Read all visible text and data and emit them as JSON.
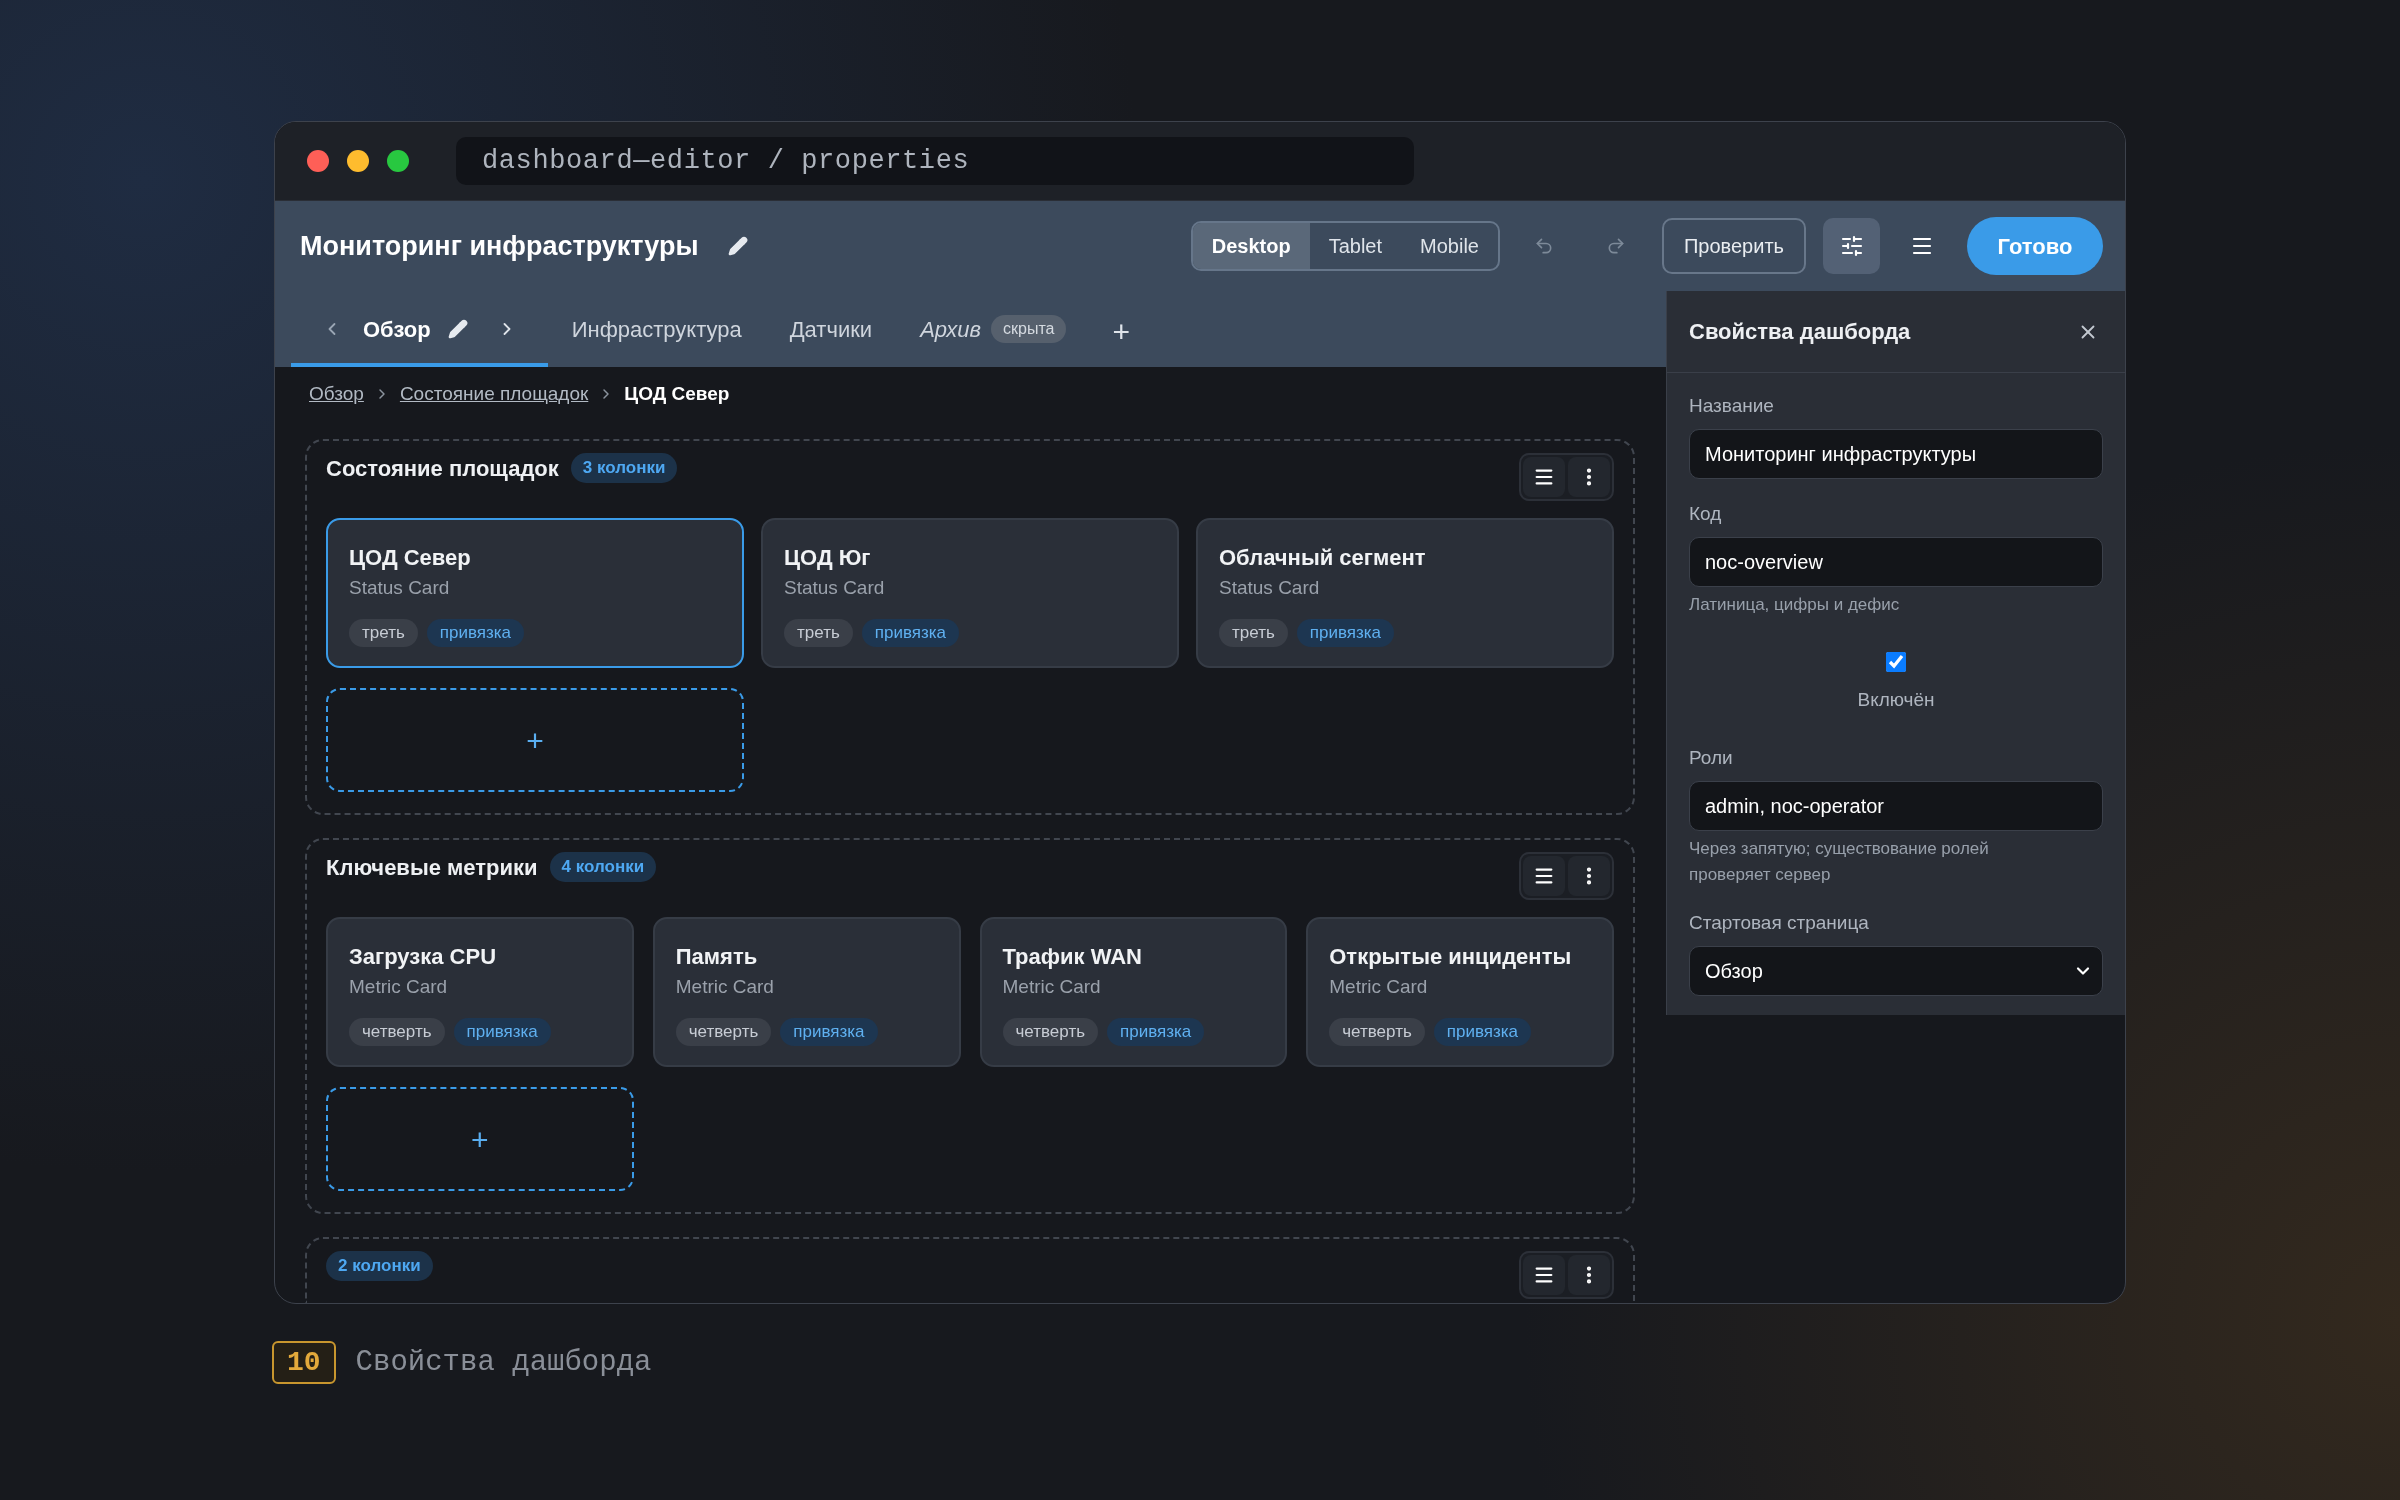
{
  "window": {
    "title": "dashboard—editor / properties"
  },
  "header": {
    "title": "Мониторинг инфраструктуры",
    "views": [
      {
        "label": "Desktop",
        "selected": true
      },
      {
        "label": "Tablet",
        "selected": false
      },
      {
        "label": "Mobile",
        "selected": false
      }
    ],
    "undo": {
      "disabled": true
    },
    "redo": {
      "disabled": true
    },
    "check_button": "Проверить",
    "properties_toggle": {
      "pressed": true
    },
    "done_button": "Готово"
  },
  "tabs": [
    {
      "label": "Обзор",
      "selected": true,
      "hidden": false
    },
    {
      "label": "Инфраструктура",
      "selected": false,
      "hidden": false
    },
    {
      "label": "Датчики",
      "selected": false,
      "hidden": false
    },
    {
      "label": "Архив",
      "selected": false,
      "hidden": true,
      "badge": "скрыта"
    }
  ],
  "add_tab": "+",
  "breadcrumb": [
    {
      "label": "Обзор",
      "current": false
    },
    {
      "label": "Состояние площадок",
      "current": false
    },
    {
      "label": "ЦОД Север",
      "current": true
    }
  ],
  "sections": [
    {
      "kind": "thirds",
      "title": "Состояние площадок",
      "badge": "3 колонки",
      "cards": [
        {
          "title": "ЦОД Север",
          "type": "Status Card",
          "selected": true,
          "tags": [
            {
              "kind": "size",
              "label": "треть"
            },
            {
              "kind": "binding",
              "label": "привязка"
            }
          ]
        },
        {
          "title": "ЦОД Юг",
          "type": "Status Card",
          "selected": false,
          "tags": [
            {
              "kind": "size",
              "label": "треть"
            },
            {
              "kind": "binding",
              "label": "привязка"
            }
          ]
        },
        {
          "title": "Облачный сегмент",
          "type": "Status Card",
          "selected": false,
          "tags": [
            {
              "kind": "size",
              "label": "треть"
            },
            {
              "kind": "binding",
              "label": "привязка"
            }
          ]
        }
      ],
      "add_slot": "+"
    },
    {
      "kind": "quarters",
      "title": "Ключевые метрики",
      "badge": "4 колонки",
      "cards": [
        {
          "title": "Загрузка CPU",
          "type": "Metric Card",
          "selected": false,
          "tags": [
            {
              "kind": "size",
              "label": "четверть"
            },
            {
              "kind": "binding",
              "label": "привязка"
            }
          ]
        },
        {
          "title": "Память",
          "type": "Metric Card",
          "selected": false,
          "tags": [
            {
              "kind": "size",
              "label": "четверть"
            },
            {
              "kind": "binding",
              "label": "привязка"
            }
          ]
        },
        {
          "title": "Трафик WAN",
          "type": "Metric Card",
          "selected": false,
          "tags": [
            {
              "kind": "size",
              "label": "четверть"
            },
            {
              "kind": "binding",
              "label": "привязка"
            }
          ]
        },
        {
          "title": "Открытые инциденты",
          "type": "Metric Card",
          "selected": false,
          "tags": [
            {
              "kind": "size",
              "label": "четверть"
            },
            {
              "kind": "binding",
              "label": "привязка"
            }
          ]
        }
      ],
      "add_slot": "+"
    },
    {
      "kind": "halves",
      "badge": "2 колонки"
    }
  ],
  "properties": {
    "title": "Свойства дашборда",
    "fields": [
      {
        "kind": "text",
        "label": "Название",
        "value": "Мониторинг инфраструктуры"
      },
      {
        "kind": "text",
        "label": "Код",
        "value": "noc-overview",
        "hint": "Латиница, цифры и дефис"
      },
      {
        "kind": "checkbox",
        "label": "Включён",
        "checked": true
      },
      {
        "kind": "text",
        "label": "Роли",
        "value": "admin, noc-operator",
        "hint": "Через запятую; существование ролей проверяет сервер"
      },
      {
        "kind": "select",
        "label": "Стартовая страница",
        "value": "Обзор"
      }
    ]
  },
  "caption": {
    "number": "10",
    "text": "Свойства дашборда"
  }
}
